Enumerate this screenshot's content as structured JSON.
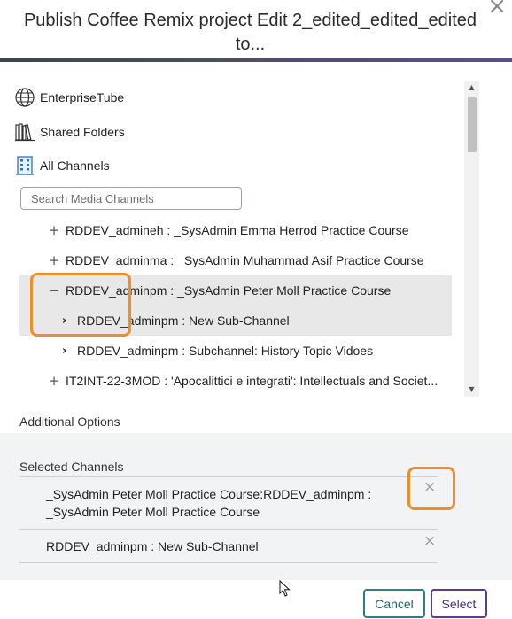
{
  "dialog": {
    "title": "Publish Coffee Remix project Edit 2_edited_edited_edited to...",
    "close_glyph": "×"
  },
  "tree": {
    "roots": [
      {
        "label": "EnterpriseTube",
        "icon": "globe-icon"
      },
      {
        "label": "Shared Folders",
        "icon": "library-books-icon"
      },
      {
        "label": "All Channels",
        "icon": "channels-building-icon"
      }
    ],
    "search": {
      "placeholder": "Search Media Channels",
      "value": ""
    },
    "channels": [
      {
        "toggle": "+",
        "label": "RDDEV_admineh : _SysAdmin Emma Herrod Practice Course",
        "selected": false
      },
      {
        "toggle": "+",
        "label": "RDDEV_adminma : _SysAdmin Muhammad Asif Practice Course",
        "selected": false
      },
      {
        "toggle": "−",
        "label": "RDDEV_adminpm : _SysAdmin Peter Moll Practice Course",
        "selected": true
      },
      {
        "toggle": "›",
        "label": "RDDEV_adminpm : New Sub-Channel",
        "selected": true,
        "child": true
      },
      {
        "toggle": "›",
        "label": "RDDEV_adminpm : Subchannel: History Topic Vidoes",
        "selected": false,
        "child": true
      },
      {
        "toggle": "+",
        "label": "IT2INT-22-3MOD : 'Apocalittici e integrati': Intellectuals and Societ...",
        "selected": false
      }
    ]
  },
  "additional_options": {
    "label": "Additional Options"
  },
  "selected_channels": {
    "label": "Selected Channels",
    "items": [
      {
        "line1": "_SysAdmin Peter Moll Practice Course:RDDEV_adminpm :",
        "line2": "_SysAdmin Peter Moll Practice Course"
      },
      {
        "line1": "RDDEV_adminpm : New Sub-Channel",
        "line2": ""
      }
    ],
    "remove_glyph": "×"
  },
  "buttons": {
    "cancel": "Cancel",
    "select": "Select"
  },
  "colors": {
    "highlight": "#f28c28",
    "cancel_border": "#2f7f86",
    "select_border": "#5b3d8a",
    "selected_row": "#e8e8e8"
  }
}
